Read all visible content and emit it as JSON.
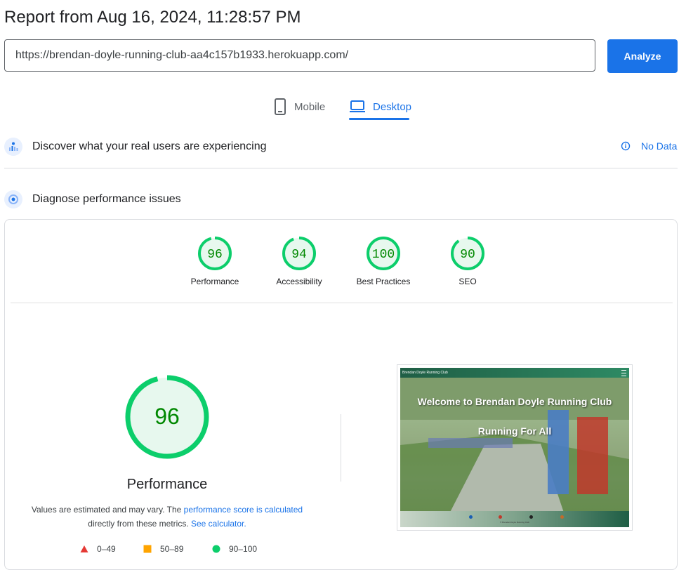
{
  "report": {
    "title": "Report from Aug 16, 2024, 11:28:57 PM"
  },
  "url_input": {
    "value": "https://brendan-doyle-running-club-aa4c157b1933.herokuapp.com/"
  },
  "analyze_button": {
    "label": "Analyze"
  },
  "device_tabs": [
    {
      "label": "Mobile",
      "icon": "phone-icon",
      "active": false
    },
    {
      "label": "Desktop",
      "icon": "laptop-icon",
      "active": true
    }
  ],
  "real_users": {
    "title": "Discover what your real users are experiencing",
    "status": "No Data",
    "icon": "users-chart-icon",
    "status_icon": "info-icon"
  },
  "diagnose": {
    "title": "Diagnose performance issues",
    "icon": "gauge-icon"
  },
  "scores": [
    {
      "label": "Performance",
      "value": 96
    },
    {
      "label": "Accessibility",
      "value": 94
    },
    {
      "label": "Best Practices",
      "value": 100
    },
    {
      "label": "SEO",
      "value": 90
    }
  ],
  "main_score": {
    "value": 96,
    "label": "Performance",
    "note_prefix": "Values are estimated and may vary. The ",
    "note_link1": "performance score is calculated",
    "note_middle": " directly from these metrics. ",
    "note_link2": "See calculator."
  },
  "legend": [
    {
      "range": "0–49",
      "shape": "triangle",
      "color": "#e53935"
    },
    {
      "range": "50–89",
      "shape": "square",
      "color": "#ffa400"
    },
    {
      "range": "90–100",
      "shape": "circle",
      "color": "#0cce6b"
    }
  ],
  "screenshot": {
    "nav_title": "Brendan Doyle Running Club",
    "heading": "Welcome to Brendan Doyle Running Club",
    "subheading": "Running For All",
    "copyright": "© Brendan Doyle Running Club"
  },
  "colors": {
    "accent": "#1a73e8",
    "good": "#0cce6b",
    "good_bg": "#e7f8ee",
    "good_text": "#008800"
  }
}
